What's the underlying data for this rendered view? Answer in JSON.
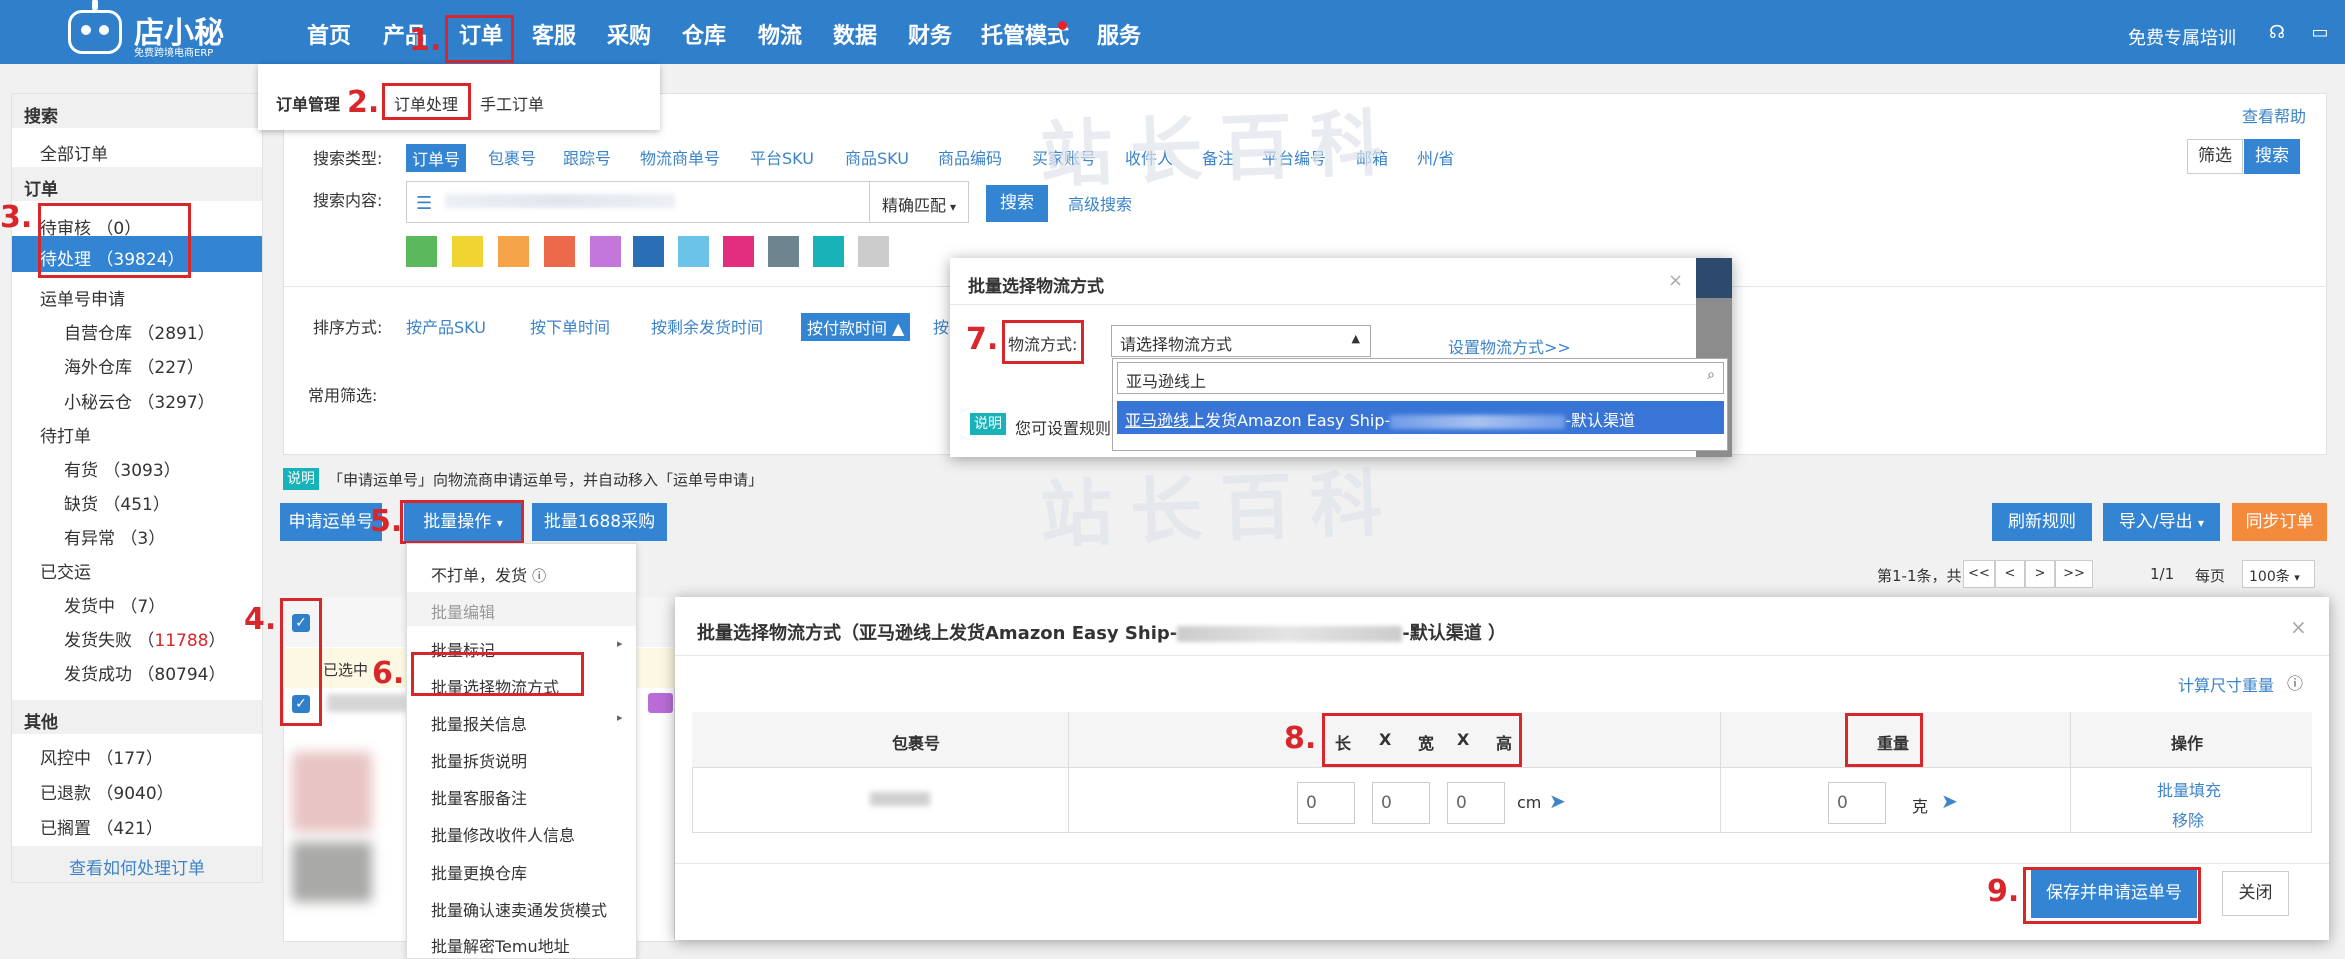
{
  "app": {
    "logo_name": "店小秘",
    "logo_sub": "免费跨境电商ERP"
  },
  "nav": {
    "items": [
      "首页",
      "产品",
      "订单",
      "客服",
      "采购",
      "仓库",
      "物流",
      "数据",
      "财务",
      "托管模式",
      "服务"
    ],
    "right_label": "免费专属培训",
    "icons": [
      "headset-icon",
      "book-icon"
    ]
  },
  "order_menu": {
    "group": "订单管理",
    "items": [
      "订单处理",
      "手工订单"
    ]
  },
  "steps": [
    "1.",
    "2.",
    "3.",
    "4.",
    "5.",
    "6.",
    "7.",
    "8.",
    "9."
  ],
  "sidebar": {
    "search_head": "搜索",
    "all_orders": "全部订单",
    "order_head": "订单",
    "pending_review": "待审核 （0）",
    "pending_process": "待处理 （39824）",
    "tracking_apply": "运单号申请",
    "own_wh": "自营仓库 （2891）",
    "overseas_wh": "海外仓库 （227）",
    "cloud_wh": "小秘云仓 （3297）",
    "to_print": "待打单",
    "in_stock": "有货 （3093）",
    "out_stock": "缺货 （451）",
    "abnormal": "有异常 （3）",
    "shipped": "已交运",
    "shipping": "发货中 （7）",
    "ship_failed_label": "发货失败 （",
    "ship_failed_count": "11788",
    "ship_failed_end": "）",
    "ship_ok": "发货成功 （80794）",
    "other_head": "其他",
    "risk": "风控中 （177）",
    "refunded": "已退款 （9040）",
    "ignored": "已搁置 （421）",
    "help_link": "查看如何处理订单"
  },
  "search": {
    "help": "查看帮助",
    "type_label": "搜索类型:",
    "types": [
      "订单号",
      "包裹号",
      "跟踪号",
      "物流商单号",
      "平台SKU",
      "商品SKU",
      "商品编码",
      "买家账号",
      "收件人",
      "备注",
      "平台编号",
      "邮箱",
      "州/省"
    ],
    "content_label": "搜索内容:",
    "match": "精确匹配",
    "search_btn": "搜索",
    "advanced": "高级搜索",
    "filter_btn": "筛选",
    "search_btn2": "搜索",
    "sort_label": "排序方式:",
    "sorts": [
      "按产品SKU",
      "按下单时间",
      "按剩余发货时间",
      "按付款时间 ▲",
      "按"
    ],
    "common_label": "常用筛选:"
  },
  "swatch_colors": [
    "#5cb85c",
    "#f0d431",
    "#f5a449",
    "#ec6a4c",
    "#c477db",
    "#2a6fb5",
    "#6cc3ea",
    "#e32d7e",
    "#6e8590",
    "#17b3b8",
    "#cccccc"
  ],
  "notice": {
    "badge": "说明",
    "text": "「申请运单号」向物流商申请运单号，并自动移入「运单号申请」"
  },
  "toolbar": {
    "apply": "申请运单号",
    "batch_ops": "批量操作",
    "batch_1688": "批量1688采购",
    "refresh": "刷新规则",
    "import_export": "导入/导出",
    "sync": "同步订单"
  },
  "pagination": {
    "summary": "第1-1条，共1条",
    "btns": [
      "<<",
      "<",
      ">",
      ">>"
    ],
    "page": "1/1",
    "per_label": "每页",
    "per_value": "100条"
  },
  "table": {
    "selected_text": "已选中"
  },
  "batch_menu": {
    "items": [
      "不打单，发货",
      "批量编辑",
      "批量标记",
      "批量选择物流方式",
      "批量报关信息",
      "批量拆货说明",
      "批量客服备注",
      "批量修改收件人信息",
      "批量更换仓库",
      "批量确认速卖通发货模式",
      "批量解密Temu地址"
    ]
  },
  "dialog1": {
    "title": "批量选择物流方式",
    "label": "物流方式:",
    "select_placeholder": "请选择物流方式",
    "setting_link": "设置物流方式>>",
    "search_value": "亚马逊线上",
    "option_prefix": "亚马逊线上",
    "option_mid": "发货Amazon Easy Ship-",
    "option_suffix": "-默认渠道",
    "note_badge": "说明",
    "note_text": "您可设置规则"
  },
  "dialog2": {
    "title_prefix": "批量选择物流方式（亚马逊线上发货Amazon Easy Ship-",
    "title_suffix": "-默认渠道 ）",
    "calc_link": "计算尺寸重量",
    "col_package": "包裹号",
    "dims": [
      "长",
      "X",
      "宽",
      "X",
      "高"
    ],
    "col_weight": "重量",
    "col_ops": "操作",
    "dim_values": [
      "0",
      "0",
      "0"
    ],
    "unit_cm": "cm",
    "weight_value": "0",
    "unit_g": "克",
    "fill": "批量填充",
    "remove": "移除",
    "save": "保存并申请运单号",
    "close": "关闭"
  },
  "watermark": "站长百科"
}
